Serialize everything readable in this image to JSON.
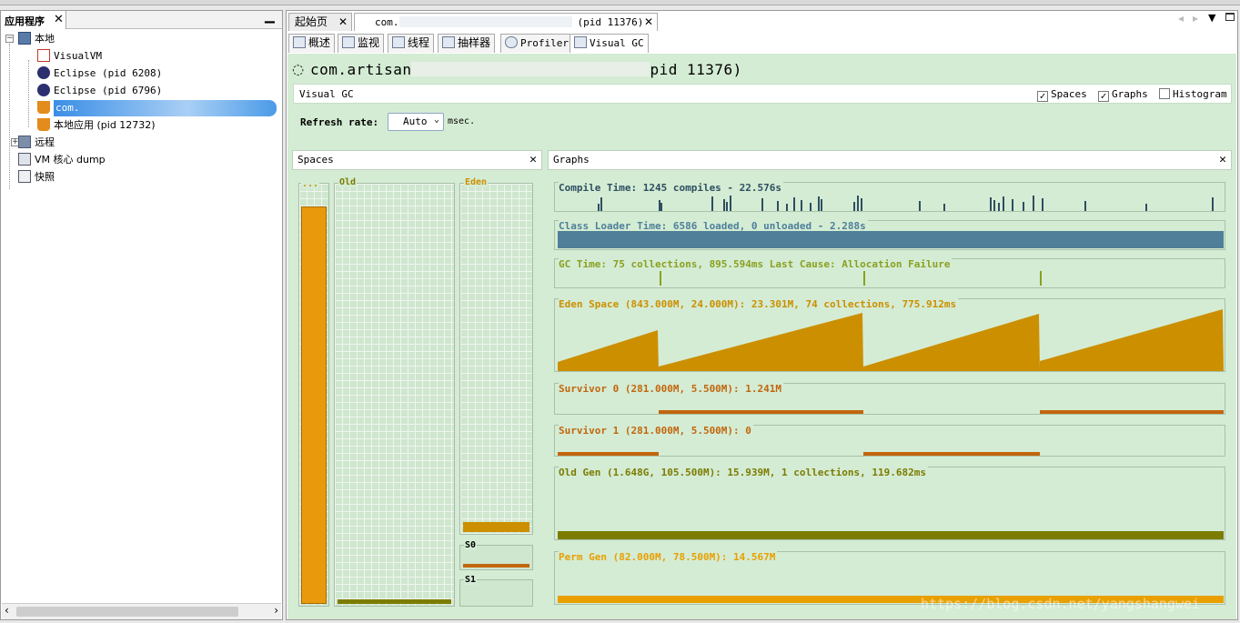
{
  "left_panel": {
    "tab_title": "应用程序",
    "tree": [
      {
        "label": "本地"
      },
      {
        "label": "VisualVM"
      },
      {
        "label": "Eclipse (pid 6208)"
      },
      {
        "label": "Eclipse (pid 6796)"
      },
      {
        "label": "com."
      },
      {
        "label": "本地应用 (pid 12732)"
      },
      {
        "label": "远程"
      },
      {
        "label": "VM 核心 dump"
      },
      {
        "label": "快照"
      }
    ]
  },
  "tabs": {
    "start_page": "起始页",
    "app_tab_prefix": "com.",
    "app_tab_pid": "(pid 11376)"
  },
  "subtabs": [
    "概述",
    "监视",
    "线程",
    "抽样器",
    "Profiler",
    "Visual GC"
  ],
  "process": {
    "name": "com.artisan",
    "pid_label": "pid 11376)"
  },
  "visual_gc": {
    "title": "Visual GC",
    "checkboxes": [
      {
        "label": "Spaces",
        "checked": true
      },
      {
        "label": "Graphs",
        "checked": true
      },
      {
        "label": "Histogram",
        "checked": false
      }
    ],
    "refresh_label": "Refresh rate:",
    "refresh_value": "Auto",
    "refresh_unit": "msec."
  },
  "spaces_panel": {
    "title": "Spaces",
    "labels": {
      "perm": "...",
      "old": "Old",
      "eden": "Eden",
      "s0": "S0",
      "s1": "S1"
    },
    "fill_fractions": {
      "perm": 0.95,
      "old": 0.01,
      "eden": 0.03,
      "s0": 0.2,
      "s1": 0.0
    }
  },
  "graphs_panel": {
    "title": "Graphs",
    "graphs": [
      {
        "label": "Compile Time: 1245 compiles - 22.576s",
        "color": "#2e4e61"
      },
      {
        "label": "Class Loader Time: 6586 loaded, 0 unloaded - 2.288s",
        "color": "#4f7f99"
      },
      {
        "label": "GC Time: 75 collections, 895.594ms Last Cause: Allocation Failure",
        "color": "#8aa020"
      },
      {
        "label": "Eden Space (843.000M, 24.000M): 23.301M, 74 collections, 775.912ms",
        "color": "#cc8f00"
      },
      {
        "label": "Survivor 0 (281.000M, 5.500M): 1.241M",
        "color": "#c2660c"
      },
      {
        "label": "Survivor 1 (281.000M, 5.500M): 0",
        "color": "#c2660c"
      },
      {
        "label": "Old Gen (1.648G, 105.500M): 15.939M, 1 collections, 119.682ms",
        "color": "#7c7c00"
      },
      {
        "label": "Perm Gen (82.000M, 78.500M): 14.567M",
        "color": "#e8a000"
      }
    ]
  },
  "watermark": "https://blog.csdn.net/yangshangwei"
}
